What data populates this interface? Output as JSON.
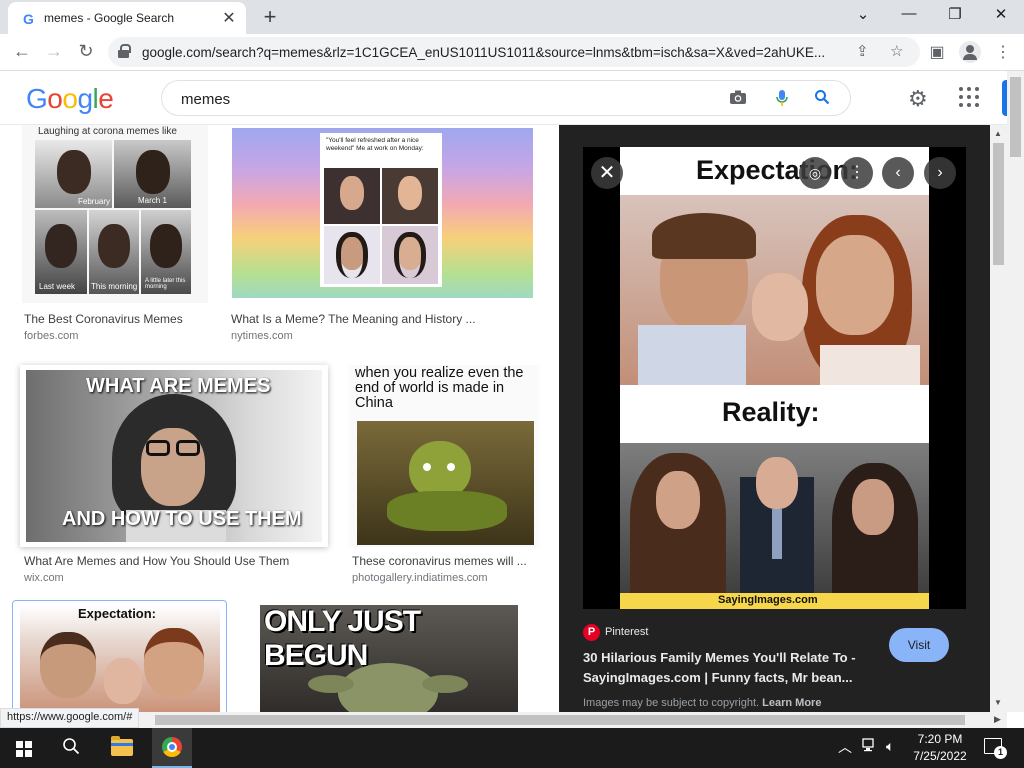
{
  "browser": {
    "tab_favicon": "G",
    "tab_title": "memes - Google Search",
    "tab_close": "✕",
    "new_tab": "+",
    "url": "google.com/search?q=memes&rlz=1C1GCEA_enUS1011US1011&source=lnms&tbm=isch&sa=X&ved=2ahUKE...",
    "status_url": "https://www.google.com/#"
  },
  "google": {
    "logo_letters": [
      "G",
      "o",
      "o",
      "g",
      "l",
      "e"
    ],
    "logo_colors": [
      "#4285f4",
      "#ea4335",
      "#fbbc05",
      "#4285f4",
      "#34a853",
      "#ea4335"
    ],
    "query": "memes"
  },
  "results": [
    {
      "title": "The Best Coronavirus Memes",
      "site": "forbes.com",
      "caption": "Laughing at corona memes like",
      "labels": [
        "February",
        "March 1",
        "Last week",
        "This morning",
        "A little later this morning"
      ]
    },
    {
      "title": "What Is a Meme? The Meaning and History ...",
      "site": "nytimes.com",
      "caption": "\"You'll feel refreshed after a nice weekend\" Me at work on Monday:"
    },
    {
      "title": "What Are Memes and How You Should Use Them",
      "site": "wix.com",
      "caption_top": "WHAT ARE MEMES",
      "caption_bottom": "AND HOW TO USE THEM"
    },
    {
      "title": "These coronavirus memes will ...",
      "site": "photogallery.indiatimes.com",
      "caption": "when you realize even the end of world is made in China"
    },
    {
      "caption": "Expectation:"
    },
    {
      "caption": "ONLY JUST BEGUN"
    }
  ],
  "panel": {
    "meme_top": "Expectation:",
    "meme_mid": "Reality:",
    "meme_watermark": "SayingImages.com",
    "source_name": "Pinterest",
    "title_line1": "30 Hilarious Family Memes You'll Relate To -",
    "title_line2": "SayingImages.com | Funny facts, Mr bean...",
    "visit_label": "Visit",
    "copyright_text": "Images may be subject to copyright.",
    "learn_more": "Learn More"
  },
  "taskbar": {
    "time": "7:20 PM",
    "date": "7/25/2022",
    "notification_count": "1"
  },
  "colors": {
    "accent": "#1a73e8",
    "panel_bg": "#222222",
    "visit_button": "#8ab4f8",
    "pinterest": "#e60023"
  }
}
